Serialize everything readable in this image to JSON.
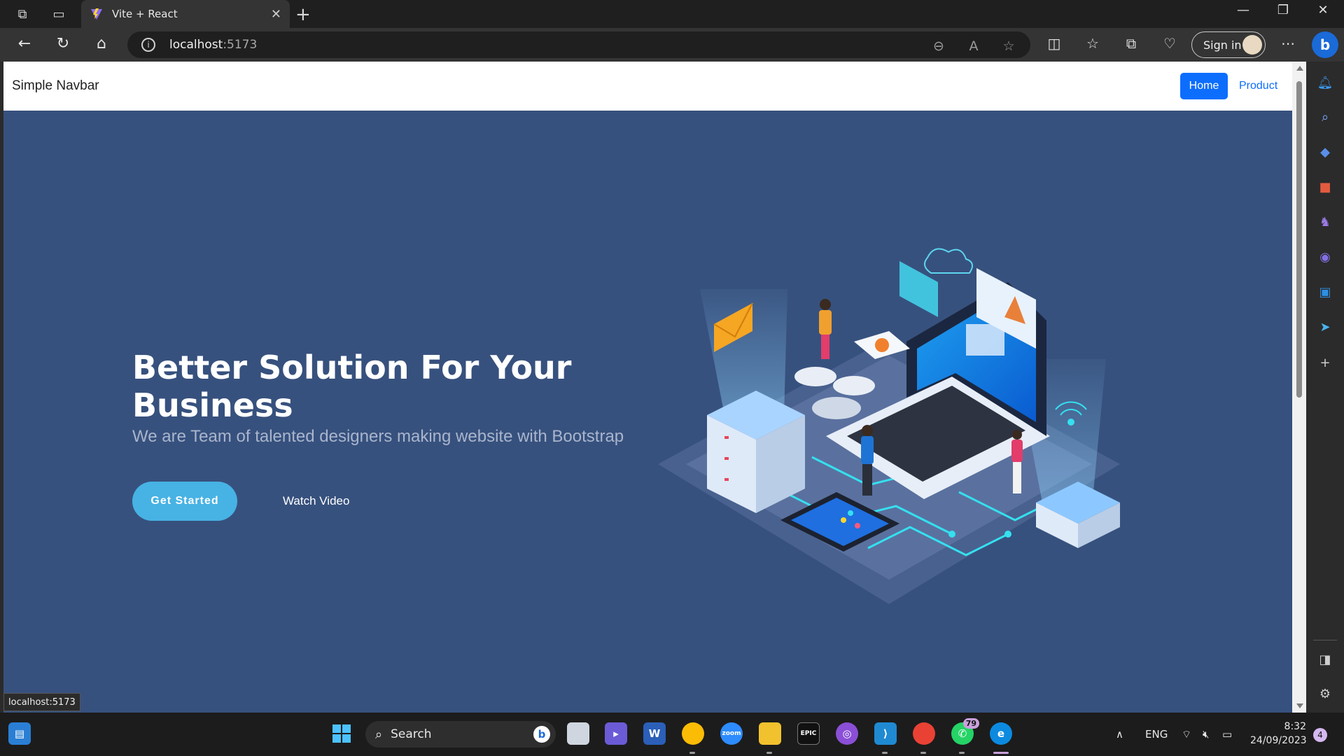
{
  "browser": {
    "tab_title": "Vite + React",
    "url_host": "localhost",
    "url_port": ":5173",
    "sign_in_label": "Sign in",
    "status_url": "localhost:5173"
  },
  "navbar": {
    "brand": "Simple Navbar",
    "links": [
      "Home",
      "Product"
    ]
  },
  "hero": {
    "title": "Better Solution For Your Business",
    "subtitle": "We are Team of talented designers making website with Bootstrap",
    "primary_button": "Get Started",
    "secondary_button": "Watch Video"
  },
  "taskbar": {
    "search_label": "Search",
    "whatsapp_badge": "79",
    "language": "ENG",
    "time": "8:32",
    "date": "24/09/2023",
    "notification_count": "4"
  },
  "colors": {
    "hero_bg": "#37517e",
    "accent": "#47b2e4",
    "nav_link": "#0d6efd"
  },
  "icons": [
    "tab-actions-icon",
    "tab-list-icon",
    "back-icon",
    "refresh-icon",
    "home-icon",
    "info-icon",
    "zoom-out-icon",
    "read-aloud-icon",
    "favorite-star-icon",
    "split-screen-icon",
    "favorites-icon",
    "collections-icon",
    "performance-icon",
    "more-icon",
    "copilot-icon",
    "windows-start-icon",
    "file-explorer-icon",
    "vscode-icon",
    "chrome-icon",
    "whatsapp-icon",
    "edge-icon",
    "wifi-icon",
    "volume-icon",
    "battery-icon"
  ]
}
